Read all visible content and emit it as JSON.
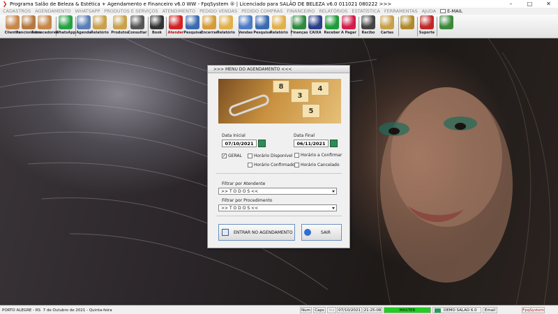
{
  "window": {
    "title": "Programa Salão de Beleza & Estética + Agendamento e Financeiro v6.0 WW - FpqSystem ® | Licenciado para  SALÃO DE BELEZA v6.0 011021 080222 >>>",
    "minimize_glyph": "–",
    "maximize_glyph": "□",
    "close_glyph": "✕"
  },
  "menu": [
    {
      "label": "CADASTROS",
      "enabled": false
    },
    {
      "label": "AGENDAMENTO",
      "enabled": false
    },
    {
      "label": "WHATSAPP",
      "enabled": false
    },
    {
      "label": "PRODUTOS E SERVIÇOS",
      "enabled": false
    },
    {
      "label": "ATENDIMENTO",
      "enabled": false
    },
    {
      "label": "PEDIDO VENDAS",
      "enabled": false
    },
    {
      "label": "PEDIDO COMPRAS",
      "enabled": false
    },
    {
      "label": "FINANCEIRO",
      "enabled": false
    },
    {
      "label": "RELATÓRIOS",
      "enabled": false
    },
    {
      "label": "ESTATÍSTICA",
      "enabled": false
    },
    {
      "label": "FERRAMENTAS",
      "enabled": false
    },
    {
      "label": "AJUDA",
      "enabled": false
    },
    {
      "label": "E-MAIL",
      "enabled": true
    }
  ],
  "toolbar": [
    {
      "label": "Clientes",
      "icon": "people-icon",
      "color": "#c7874a"
    },
    {
      "label": "Funcionários",
      "icon": "employees-icon",
      "color": "#b5793f"
    },
    {
      "label": "Fornecedores",
      "icon": "supplier-icon",
      "color": "#c5874a"
    },
    {
      "label": "WhatsApp",
      "icon": "whatsapp-icon",
      "color": "#25a244"
    },
    {
      "label": "Agenda",
      "icon": "calendar-icon",
      "color": "#5a7fb8"
    },
    {
      "label": "Relatório",
      "icon": "report-icon",
      "color": "#c9a14a"
    },
    {
      "label": "Produtos",
      "icon": "products-icon",
      "color": "#c9a14a"
    },
    {
      "label": "Consultar",
      "icon": "search-products-icon",
      "color": "#555555"
    },
    {
      "label": "Book",
      "icon": "camera-icon",
      "color": "#333333"
    },
    {
      "label": "Atender",
      "icon": "scissors-icon",
      "color": "#d22222",
      "red": true
    },
    {
      "label": "Pesquisa",
      "icon": "magnifier-icon",
      "color": "#3a6ab0"
    },
    {
      "label": "Encerrar",
      "icon": "folder-icon",
      "color": "#d59b38"
    },
    {
      "label": "Relatório",
      "icon": "report-icon",
      "color": "#e0b04a"
    },
    {
      "label": "Vendas",
      "icon": "sales-icon",
      "color": "#4b7cc6"
    },
    {
      "label": "Pesquisa",
      "icon": "magnifier-icon",
      "color": "#3a6ab0"
    },
    {
      "label": "Relatório",
      "icon": "report-icon",
      "color": "#e0b04a"
    },
    {
      "label": "Finanças",
      "icon": "money-icon",
      "color": "#2e8b3e"
    },
    {
      "label": "CAIXA",
      "icon": "cash-box-icon",
      "color": "#2c3f8a"
    },
    {
      "label": "Receber",
      "icon": "receive-icon",
      "color": "#1f9c3a"
    },
    {
      "label": "A Pagar",
      "icon": "pay-icon",
      "color": "#d11d4a"
    },
    {
      "label": "Recibo",
      "icon": "receipt-icon",
      "color": "#444444"
    },
    {
      "label": "Cartas",
      "icon": "letters-icon",
      "color": "#c8a04a"
    },
    {
      "label": "",
      "icon": "settings-icon",
      "color": "#b08a2a"
    },
    {
      "label": "Suporte",
      "icon": "support-icon",
      "color": "#c22828"
    },
    {
      "label": "",
      "icon": "exit-icon",
      "color": "#3a8a3a"
    }
  ],
  "dialog": {
    "title": ">>>  MENU DO AGENDAMENTO  <<<",
    "banner_digits": [
      "8",
      "3",
      "4",
      "5"
    ],
    "start_date": {
      "label": "Data Inicial",
      "value": "07/10/2021"
    },
    "end_date": {
      "label": "Data Final",
      "value": "06/11/2021"
    },
    "checks": [
      {
        "label": "GERAL",
        "checked": true
      },
      {
        "label": "Horário  Disponível",
        "checked": false
      },
      {
        "label": "Horário Confirmado",
        "checked": false
      },
      {
        "label": "Horário a Confirmar",
        "checked": false
      },
      {
        "label": "Horário Cancelado",
        "checked": false
      }
    ],
    "filter_attendant": {
      "label": "Filtrar por Atendente",
      "value": ">> T O D O S <<"
    },
    "filter_procedure": {
      "label": "Filtrar por Procedimento",
      "value": ">> T O D O S <<"
    },
    "enter_button": "ENTRAR NO AGENDAMENTO",
    "exit_button": "SAIR"
  },
  "status": {
    "location": "PORTO ALEGRE - RS",
    "date_text": "7 de Outubro de 2021 - Quinta-feira",
    "num": "Num",
    "caps": "Caps",
    "ins": "Ins",
    "date": "07/10/2021",
    "time": "21:25:08",
    "profile": "MASTER",
    "company": "DEMO SALAO 6.0",
    "email": "Email",
    "brand": "FpqSystem",
    "profile_color": "#22cc22",
    "brand_color": "#c02020"
  }
}
